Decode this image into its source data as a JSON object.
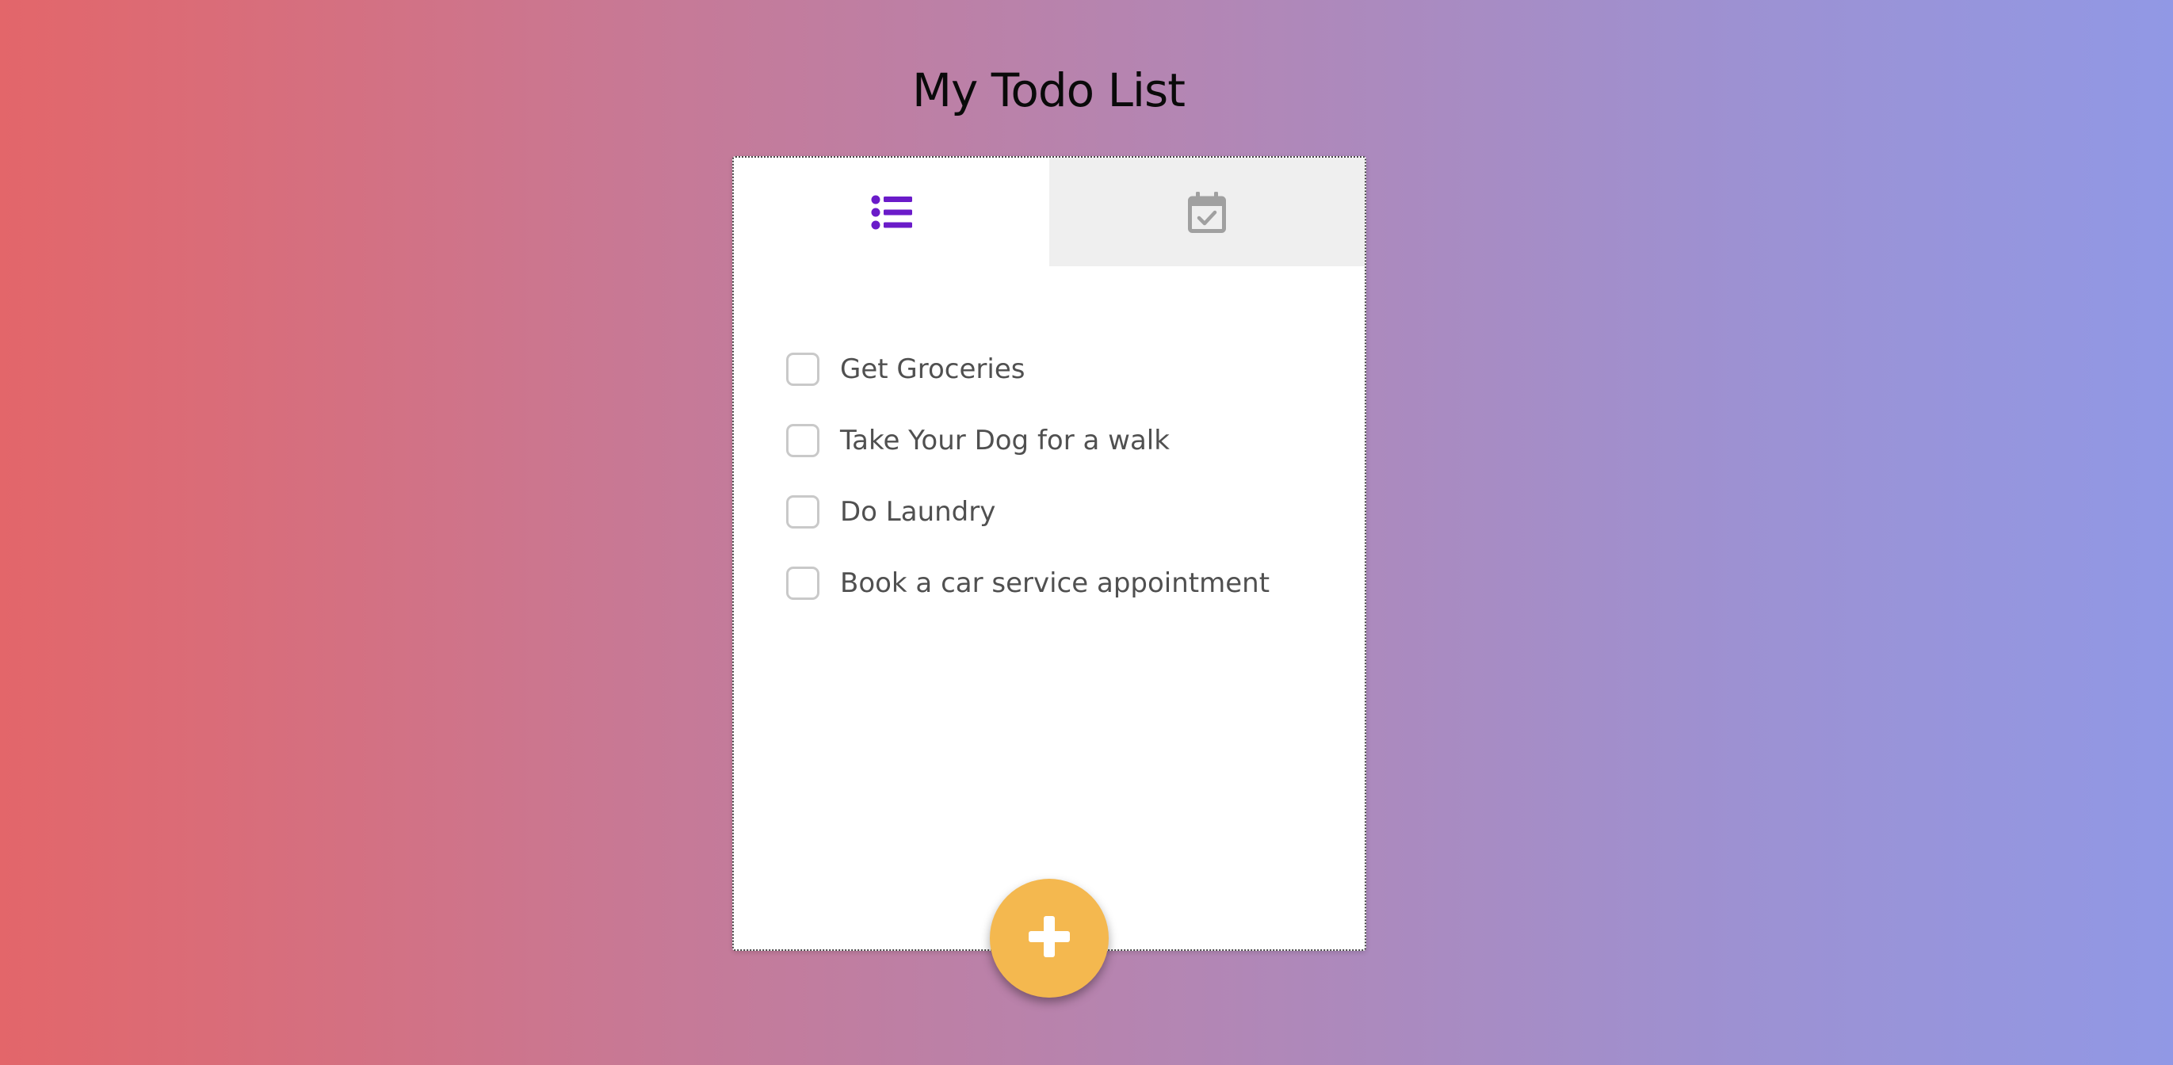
{
  "page": {
    "title": "My Todo List"
  },
  "tabs": [
    {
      "icon": "list-icon",
      "active": true
    },
    {
      "icon": "calendar-check-icon",
      "active": false
    }
  ],
  "todos": [
    {
      "label": "Get Groceries",
      "checked": false
    },
    {
      "label": "Take Your Dog for a walk",
      "checked": false
    },
    {
      "label": "Do Laundry",
      "checked": false
    },
    {
      "label": "Book a car service appointment",
      "checked": false
    }
  ],
  "fab": {
    "icon": "plus-icon"
  },
  "colors": {
    "accent": "#6a1bc9",
    "fab": "#f4b84f",
    "inactive_tab": "#efefef",
    "icon_muted": "#a0a0a0",
    "gradient_start": "#e3666a",
    "gradient_end": "#9198e5"
  }
}
